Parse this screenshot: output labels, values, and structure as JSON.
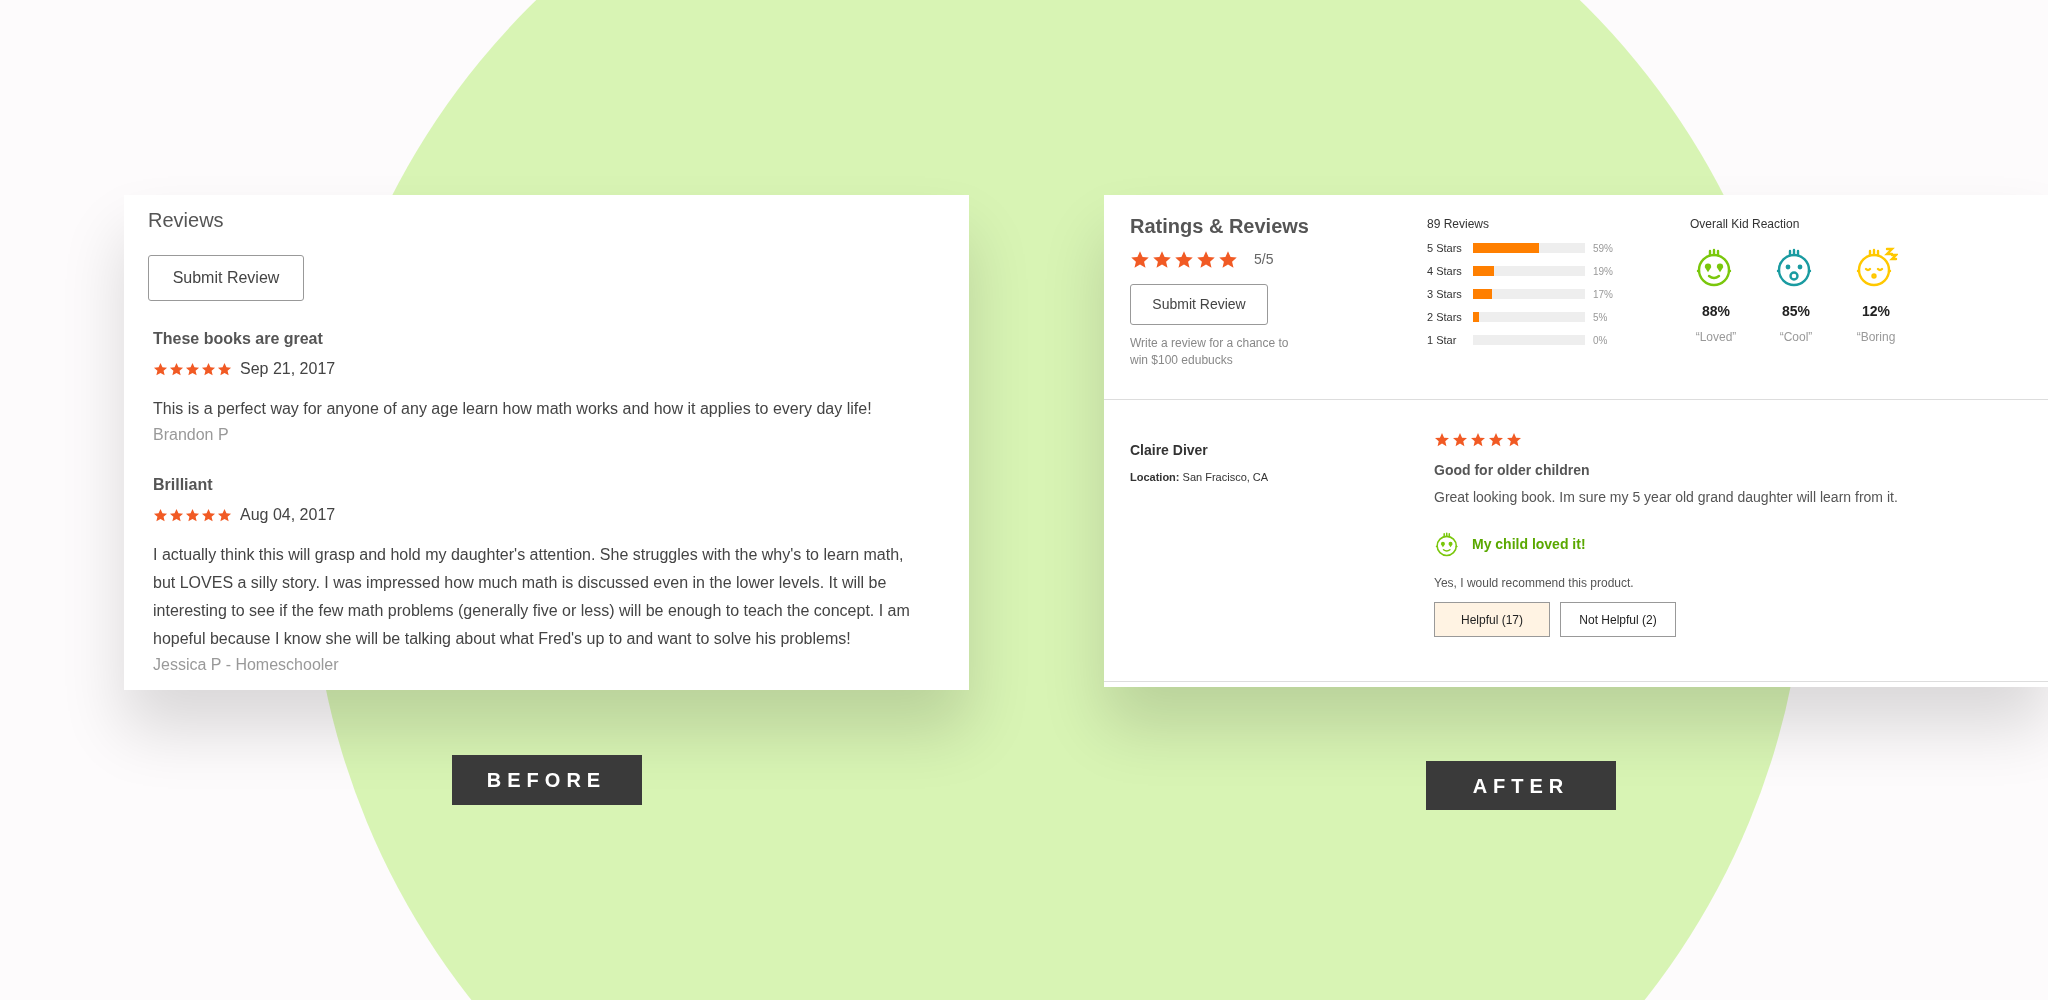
{
  "before": {
    "label": "BEFORE",
    "card": {
      "title": "Reviews",
      "submit_button": "Submit Review",
      "reviews": [
        {
          "title": "These books are great",
          "stars": 5,
          "date": "Sep 21, 2017",
          "body": "This is a perfect way for anyone of any age learn how math works and how it applies to every day life!",
          "author": "Brandon P"
        },
        {
          "title": "Brilliant",
          "stars": 5,
          "date": "Aug 04, 2017",
          "body": "I actually think this will grasp and hold my daughter's attention. She struggles with the why's to learn math, but LOVES a silly story. I was impressed how much math is discussed even in the lower levels. It will be interesting to see if the few math problems (generally five or less) will be enough to teach the concept. I am hopeful because I know she will be talking about what Fred's up to and want to solve his problems!",
          "author": "Jessica P - Homeschooler"
        }
      ]
    }
  },
  "after": {
    "label": "AFTER",
    "card": {
      "title": "Ratings & Reviews",
      "stars": 5,
      "score": "5/5",
      "submit_button": "Submit Review",
      "submit_note": "Write a review for a chance to win $100 edubucks",
      "breakdown": {
        "title": "89 Reviews",
        "rows": [
          {
            "label": "5 Stars",
            "level": 0.59,
            "percent": "59%"
          },
          {
            "label": "4 Stars",
            "level": 0.19,
            "percent": "19%"
          },
          {
            "label": "3 Stars",
            "level": 0.17,
            "percent": "17%"
          },
          {
            "label": "2 Stars",
            "level": 0.05,
            "percent": "5%"
          },
          {
            "label": "1 Star",
            "level": 0,
            "percent": "0%"
          }
        ]
      },
      "reaction": {
        "title": "Overall Kid Reaction",
        "items": [
          {
            "kind": "loved",
            "color": "#7ac70c",
            "percent": "88%",
            "label": "“Loved”"
          },
          {
            "kind": "cool",
            "color": "#1a9ba1",
            "percent": "85%",
            "label": "“Cool”"
          },
          {
            "kind": "boring",
            "color": "#ffc800",
            "percent": "12%",
            "label": "“Boring"
          }
        ]
      },
      "review": {
        "name": "Claire Diver",
        "location": "**Location:** San Fracisco, CA",
        "stars": 5,
        "title": "Good for older children",
        "body": "Great looking book. Im sure my 5 year old grand daughter will learn from it.",
        "reaction": {
          "kind": "loved",
          "text": "My child loved it!"
        },
        "recommend": "Yes, I would recommend this product.",
        "buttons": [
          {
            "label": "Helpful (17)",
            "selected": true
          },
          {
            "label": "Not Helpful (2)",
            "selected": false
          }
        ]
      }
    }
  }
}
